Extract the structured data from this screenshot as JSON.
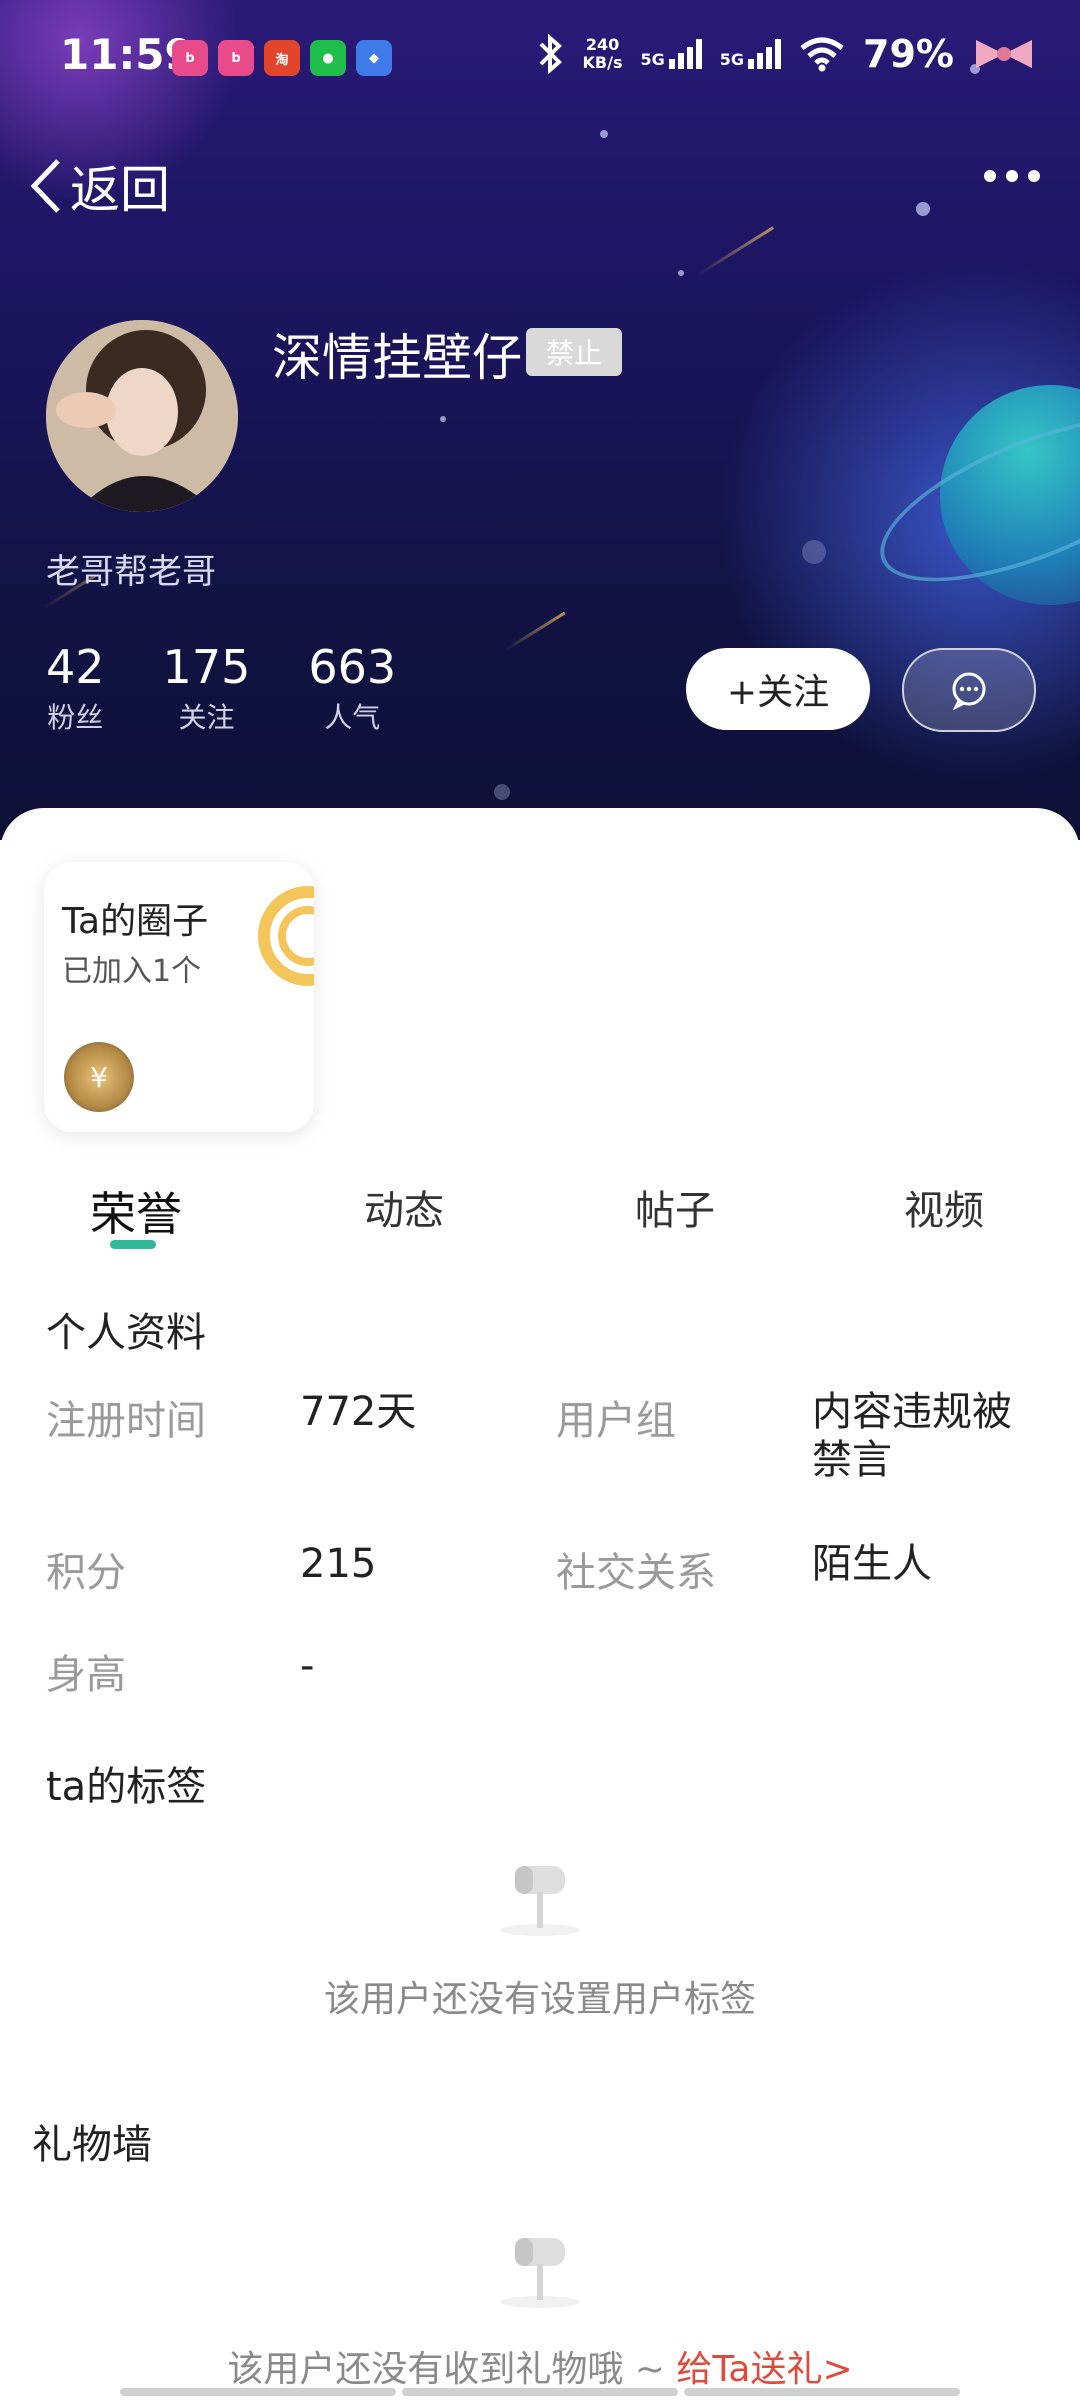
{
  "status": {
    "time": "11:59",
    "network_speed": "240",
    "network_unit": "KB/s",
    "sig1": "5G",
    "sig2": "5G",
    "battery": "79%"
  },
  "nav": {
    "back_label": "返回"
  },
  "profile": {
    "name": "深情挂壁仔",
    "badge": "禁止",
    "bio": "老哥帮老哥",
    "stats": [
      {
        "num": "42",
        "label": "粉丝"
      },
      {
        "num": "175",
        "label": "关注"
      },
      {
        "num": "663",
        "label": "人气"
      }
    ],
    "follow_label": "+关注"
  },
  "circle": {
    "title": "Ta的圈子",
    "sub": "已加入1个",
    "coin_symbol": "¥"
  },
  "tabs": [
    "荣誉",
    "动态",
    "帖子",
    "视频"
  ],
  "info": {
    "title": "个人资料",
    "reg_label": "注册时间",
    "reg_value": "772天",
    "group_label": "用户组",
    "group_value_1": "内容违规被",
    "group_value_2": "禁言",
    "points_label": "积分",
    "points_value": "215",
    "social_label": "社交关系",
    "social_value": "陌生人",
    "height_label": "身高",
    "height_value": "-"
  },
  "tags": {
    "title": "ta的标签",
    "empty": "该用户还没有设置用户标签"
  },
  "gifts": {
    "title": "礼物墙",
    "empty": "该用户还没有收到礼物哦 ~ ",
    "link": "给Ta送礼>"
  },
  "colors": {
    "accent": "#2fb89a",
    "link": "#e04a3a"
  }
}
